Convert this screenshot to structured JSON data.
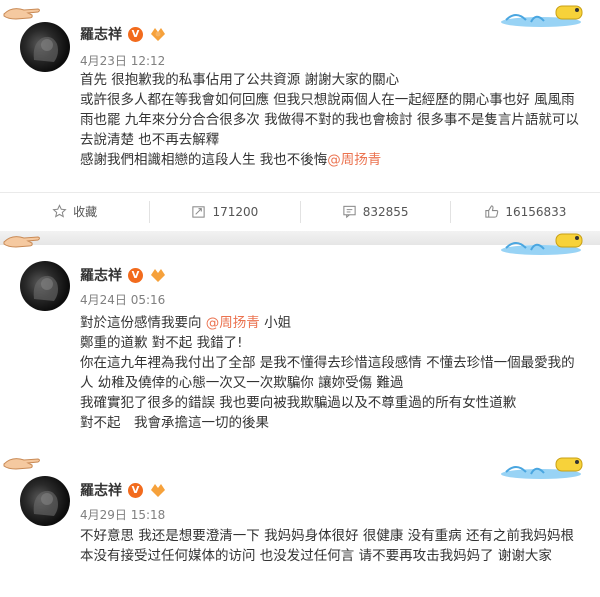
{
  "posts": [
    {
      "author": "羅志祥",
      "verified_badge": "V",
      "timestamp": "4月23日 12:12",
      "lines": [
        "首先 很抱歉我的私事佔用了公共資源 謝謝大家的關心",
        "或許很多人都在等我會如何回應 但我只想說兩個人在一起經歷的開心事也好 風風雨雨也罷 九年來分分合合很多次 我做得不對的我也會檢討 很多事不是隻言片語就可以去說清楚 也不再去解釋",
        "感謝我們相識相戀的這段人生 我也不後悔"
      ],
      "mention": "@周扬青",
      "actions": {
        "favorite": "收藏",
        "repost": "171200",
        "comment": "832855",
        "like": "16156833"
      }
    },
    {
      "author": "羅志祥",
      "verified_badge": "V",
      "timestamp": "4月24日 05:16",
      "line1_prefix": "對於這份感情我要向",
      "mention": "@周扬青",
      "line1_suffix": "小姐",
      "lines": [
        "鄭重的道歉 對不起 我錯了!",
        "你在這九年裡為我付出了全部 是我不懂得去珍惜這段感情 不懂去珍惜一個最愛我的人 幼稚及僥倖的心態一次又一次欺騙你 讓妳受傷 難過",
        "我確實犯了很多的錯誤 我也要向被我欺騙過以及不尊重過的所有女性道歉",
        "對不起　我會承擔這一切的後果"
      ]
    },
    {
      "author": "羅志祥",
      "verified_badge": "V",
      "timestamp": "4月29日 15:18",
      "lines": [
        "不好意思 我还是想要澄清一下 我妈妈身体很好 很健康 没有重病 还有之前我妈妈根本没有接受过任何媒体的访问 也没发过任何言 请不要再攻击我妈妈了 谢谢大家"
      ]
    }
  ],
  "icons": {
    "level": "fan-level-icon",
    "favorite": "star-icon",
    "repost": "repost-icon",
    "comment": "comment-icon",
    "like": "thumbs-up-icon"
  },
  "colors": {
    "mention": "#eb7350",
    "badge": "#f26b1d",
    "timestamp": "#808080"
  }
}
